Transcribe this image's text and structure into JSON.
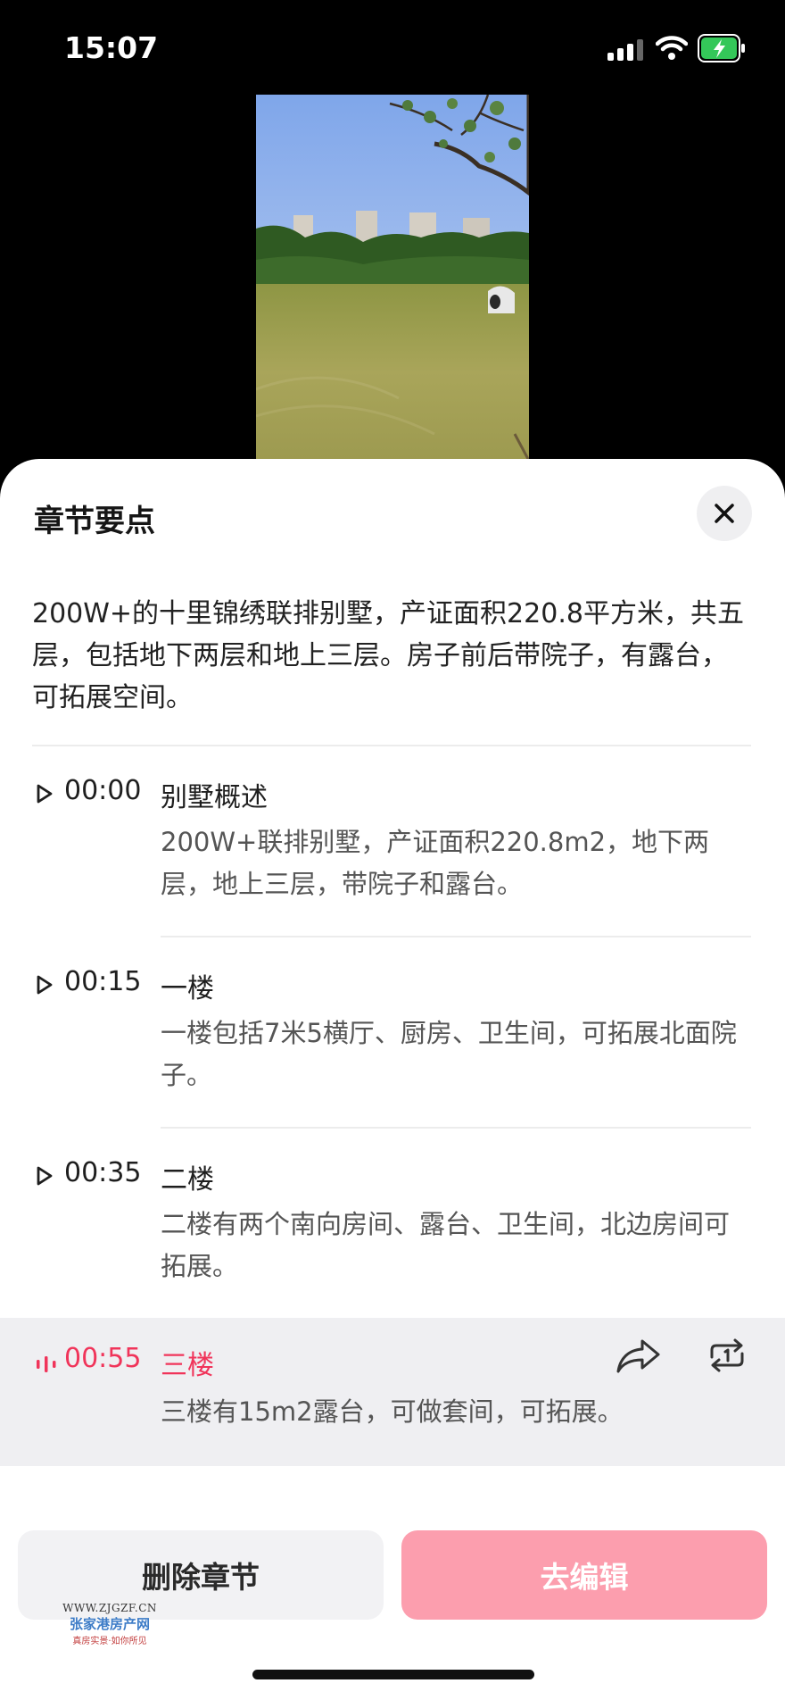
{
  "status_bar": {
    "time": "15:07"
  },
  "sheet": {
    "title": "章节要点",
    "summary": "200W+的十里锦绣联排别墅，产证面积220.8平方米，共五层，包括地下两层和地上三层。房子前后带院子，有露台，可拓展空间。"
  },
  "chapters": [
    {
      "time": "00:00",
      "title": "别墅概述",
      "desc": "200W+联排别墅，产证面积220.8m2，地下两层，地上三层，带院子和露台。"
    },
    {
      "time": "00:15",
      "title": "一楼",
      "desc": "一楼包括7米5横厅、厨房、卫生间，可拓展北面院子。"
    },
    {
      "time": "00:35",
      "title": "二楼",
      "desc": "二楼有两个南向房间、露台、卫生间，北边房间可拓展。"
    },
    {
      "time": "00:55",
      "title": "三楼",
      "desc": "三楼有15m2露台，可做套间，可拓展。",
      "active": true
    }
  ],
  "buttons": {
    "delete": "删除章节",
    "edit": "去编辑"
  },
  "watermark": {
    "url": "WWW.ZJGZF.CN",
    "name": "张家港房产网",
    "slogan": "真房实景·如你所见"
  },
  "colors": {
    "accent": "#f0345a",
    "edit_button": "#fc9eae",
    "active_row_bg": "#efeff2"
  }
}
